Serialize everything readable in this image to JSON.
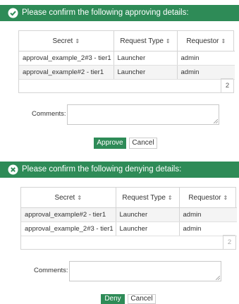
{
  "approve": {
    "title": "Please confirm the following approving details:",
    "columns": [
      "Secret",
      "Request Type",
      "Requestor"
    ],
    "rows": [
      [
        "approval_example_2#3 - tier1",
        "Launcher",
        "admin"
      ],
      [
        "approval_example#2 - tier1",
        "Launcher",
        "admin"
      ]
    ],
    "page": "2",
    "comments_label": "Comments:",
    "comments_value": "",
    "primary_label": "Approve",
    "cancel_label": "Cancel"
  },
  "deny": {
    "title": "Please confirm the following denying details:",
    "columns": [
      "Secret",
      "Request Type",
      "Requestor"
    ],
    "rows": [
      [
        "approval_example#2 - tier1",
        "Launcher",
        "admin"
      ],
      [
        "approval_example_2#3 - tier1",
        "Launcher",
        "admin"
      ]
    ],
    "page": "2",
    "comments_label": "Comments:",
    "comments_value": "",
    "primary_label": "Deny",
    "cancel_label": "Cancel"
  },
  "icons": {
    "approve": "check-circle-icon",
    "deny": "x-circle-icon",
    "sort": "sort-icon"
  },
  "colors": {
    "accent": "#2e8b57",
    "text": "#333333",
    "row_alt": "#f4f4f4"
  }
}
